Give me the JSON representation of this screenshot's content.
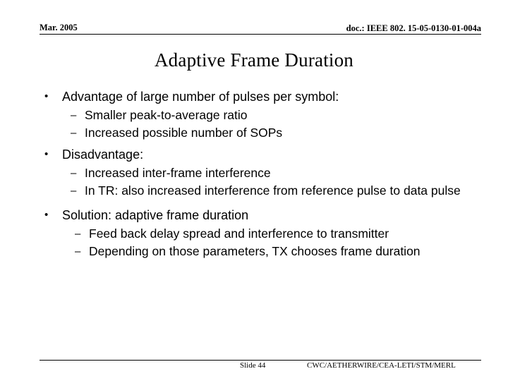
{
  "slide": {
    "header": {
      "date": "Mar. 2005",
      "doc_id": "doc.: IEEE 802. 15-05-0130-01-004a"
    },
    "title": "Adaptive Frame Duration",
    "bullet_marker": "•",
    "sub_marker": "–",
    "content": [
      {
        "level1": "Advantage of large number of pulses per symbol:",
        "level2": [
          "Smaller peak-to-average ratio",
          "Increased possible number of SOPs"
        ]
      },
      {
        "level1": "Disadvantage:",
        "level2": [
          "Increased inter-frame interference",
          "In TR: also increased interference from reference pulse to data pulse"
        ]
      },
      {
        "level1": "Solution: adaptive frame duration",
        "level2": [
          "Feed back delay spread and interference to transmitter",
          "Depending on those parameters, TX chooses frame duration"
        ]
      }
    ],
    "footer": {
      "slide_number": "Slide 44",
      "organizations": "CWC/AETHERWIRE/CEA-LETI/STM/MERL"
    },
    "colors": {
      "background": "#ffffff",
      "text": "#000000",
      "rule": "#000000"
    }
  }
}
